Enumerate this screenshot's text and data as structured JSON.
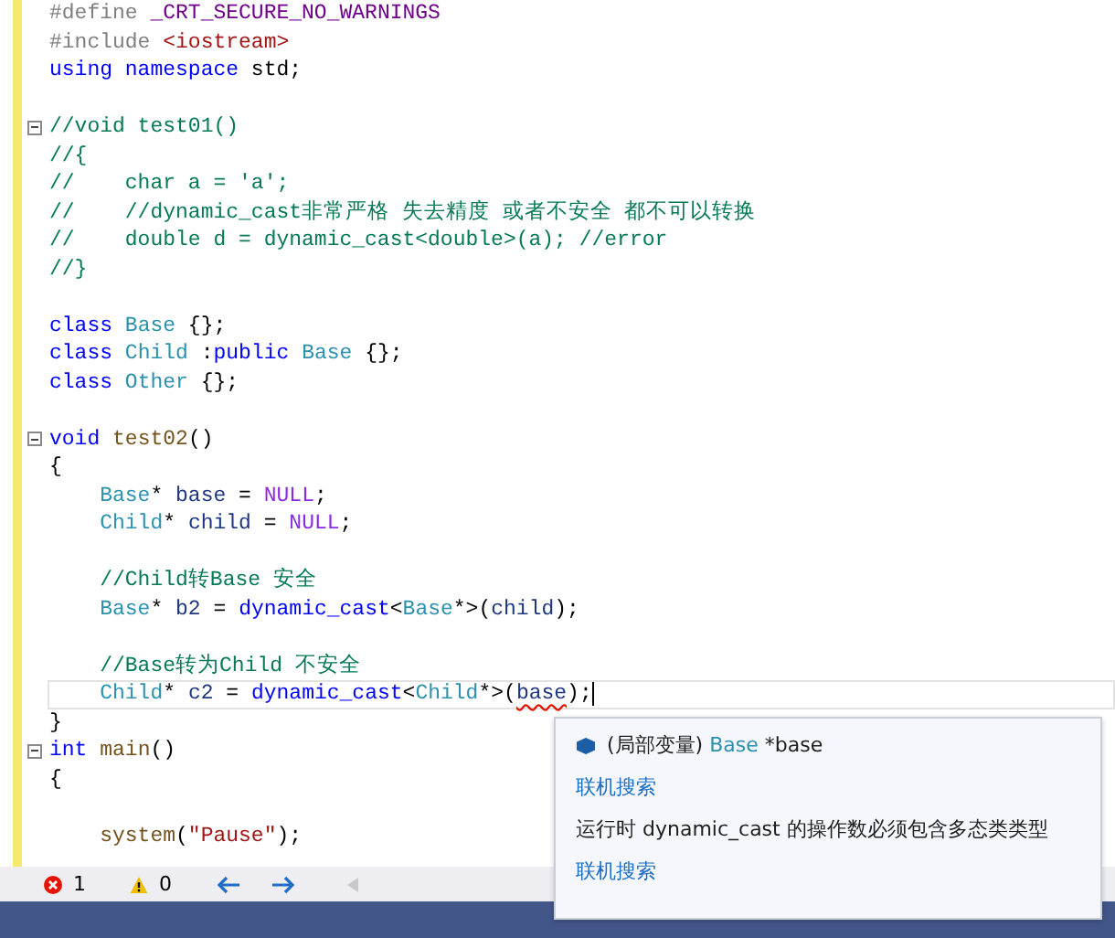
{
  "editor": {
    "lines": [
      {
        "fold": false,
        "current": false,
        "tokens": [
          {
            "kind": "macro",
            "t": "#define "
          },
          {
            "kind": "macroname",
            "t": "_CRT_SECURE_NO_WARNINGS"
          }
        ]
      },
      {
        "fold": false,
        "current": false,
        "tokens": [
          {
            "kind": "macro",
            "t": "#include "
          },
          {
            "kind": "string",
            "t": "<iostream>"
          }
        ]
      },
      {
        "fold": false,
        "current": false,
        "tokens": [
          {
            "kind": "kw",
            "t": "using namespace "
          },
          {
            "kind": "plain",
            "t": "std;"
          }
        ]
      },
      {
        "fold": false,
        "current": false
      },
      {
        "fold": true,
        "current": false,
        "tokens": [
          {
            "kind": "comment",
            "t": "//void test01()"
          }
        ]
      },
      {
        "fold": false,
        "current": false,
        "tokens": [
          {
            "kind": "comment",
            "t": "//{"
          }
        ]
      },
      {
        "fold": false,
        "current": false,
        "tokens": [
          {
            "kind": "comment",
            "t": "//    char a = 'a';"
          }
        ]
      },
      {
        "fold": false,
        "current": false,
        "tokens": [
          {
            "kind": "comment",
            "t": "//    //dynamic_cast非常严格 失去精度 或者不安全 都不可以转换"
          }
        ]
      },
      {
        "fold": false,
        "current": false,
        "tokens": [
          {
            "kind": "comment",
            "t": "//    double d = dynamic_cast<double>(a); //error"
          }
        ]
      },
      {
        "fold": false,
        "current": false,
        "tokens": [
          {
            "kind": "comment",
            "t": "//}"
          }
        ]
      },
      {
        "fold": false,
        "current": false
      },
      {
        "fold": false,
        "current": false,
        "tokens": [
          {
            "kind": "kw",
            "t": "class "
          },
          {
            "kind": "type",
            "t": "Base"
          },
          {
            "kind": "plain",
            "t": " {};"
          }
        ]
      },
      {
        "fold": false,
        "current": false,
        "tokens": [
          {
            "kind": "kw",
            "t": "class "
          },
          {
            "kind": "type",
            "t": "Child"
          },
          {
            "kind": "plain",
            "t": " :"
          },
          {
            "kind": "kw",
            "t": "public "
          },
          {
            "kind": "type",
            "t": "Base"
          },
          {
            "kind": "plain",
            "t": " {};"
          }
        ]
      },
      {
        "fold": false,
        "current": false,
        "tokens": [
          {
            "kind": "kw",
            "t": "class "
          },
          {
            "kind": "type",
            "t": "Other"
          },
          {
            "kind": "plain",
            "t": " {};"
          }
        ]
      },
      {
        "fold": false,
        "current": false
      },
      {
        "fold": true,
        "current": false,
        "tokens": [
          {
            "kind": "kw",
            "t": "void "
          },
          {
            "kind": "fn",
            "t": "test02"
          },
          {
            "kind": "plain",
            "t": "()"
          }
        ]
      },
      {
        "fold": false,
        "current": false,
        "tokens": [
          {
            "kind": "plain",
            "t": "{"
          }
        ]
      },
      {
        "fold": false,
        "current": false,
        "tokens": [
          {
            "kind": "type",
            "t": "    Base"
          },
          {
            "kind": "plain",
            "t": "* "
          },
          {
            "kind": "var",
            "t": "base"
          },
          {
            "kind": "plain",
            "t": " = "
          },
          {
            "kind": "null",
            "t": "NULL"
          },
          {
            "kind": "plain",
            "t": ";"
          }
        ]
      },
      {
        "fold": false,
        "current": false,
        "tokens": [
          {
            "kind": "type",
            "t": "    Child"
          },
          {
            "kind": "plain",
            "t": "* "
          },
          {
            "kind": "var",
            "t": "child"
          },
          {
            "kind": "plain",
            "t": " = "
          },
          {
            "kind": "null",
            "t": "NULL"
          },
          {
            "kind": "plain",
            "t": ";"
          }
        ]
      },
      {
        "fold": false,
        "current": false
      },
      {
        "fold": false,
        "current": false,
        "tokens": [
          {
            "kind": "comment",
            "t": "    //Child转Base 安全"
          }
        ]
      },
      {
        "fold": false,
        "current": false,
        "tokens": [
          {
            "kind": "type",
            "t": "    Base"
          },
          {
            "kind": "plain",
            "t": "* "
          },
          {
            "kind": "var",
            "t": "b2"
          },
          {
            "kind": "plain",
            "t": " = "
          },
          {
            "kind": "kw",
            "t": "dynamic_cast"
          },
          {
            "kind": "plain",
            "t": "<"
          },
          {
            "kind": "type",
            "t": "Base"
          },
          {
            "kind": "plain",
            "t": "*>("
          },
          {
            "kind": "var",
            "t": "child"
          },
          {
            "kind": "plain",
            "t": ");"
          }
        ]
      },
      {
        "fold": false,
        "current": false
      },
      {
        "fold": false,
        "current": false,
        "tokens": [
          {
            "kind": "comment",
            "t": "    //Base转为Child 不安全"
          }
        ]
      },
      {
        "fold": false,
        "current": true,
        "tokens": [
          {
            "kind": "type",
            "t": "    Child"
          },
          {
            "kind": "plain",
            "t": "* "
          },
          {
            "kind": "var",
            "t": "c2"
          },
          {
            "kind": "plain",
            "t": " = "
          },
          {
            "kind": "kw",
            "t": "dynamic_cast"
          },
          {
            "kind": "plain",
            "t": "<"
          },
          {
            "kind": "type",
            "t": "Child"
          },
          {
            "kind": "plain",
            "t": "*>("
          },
          {
            "kind": "err",
            "t": "base"
          },
          {
            "kind": "plain",
            "t": ");"
          }
        ]
      },
      {
        "fold": false,
        "current": false,
        "tokens": [
          {
            "kind": "plain",
            "t": "}"
          }
        ]
      },
      {
        "fold": true,
        "current": false,
        "tokens": [
          {
            "kind": "kw",
            "t": "int "
          },
          {
            "kind": "fn",
            "t": "main"
          },
          {
            "kind": "plain",
            "t": "()"
          }
        ]
      },
      {
        "fold": false,
        "current": false,
        "tokens": [
          {
            "kind": "plain",
            "t": "{"
          }
        ]
      },
      {
        "fold": false,
        "current": false
      },
      {
        "fold": false,
        "current": false,
        "tokens": [
          {
            "kind": "fn",
            "t": "    system"
          },
          {
            "kind": "plain",
            "t": "("
          },
          {
            "kind": "string",
            "t": "\"Pause\""
          },
          {
            "kind": "plain",
            "t": ");"
          }
        ]
      }
    ]
  },
  "tooltip": {
    "signature": [
      {
        "kind": "plain",
        "t": "(局部变量) "
      },
      {
        "kind": "type",
        "t": "Base"
      },
      {
        "kind": "plain",
        "t": " *base"
      }
    ],
    "links": [
      "联机搜索",
      "联机搜索"
    ],
    "message": "运行时 dynamic_cast 的操作数必须包含多态类类型"
  },
  "status_bar": {
    "errors": "1",
    "warnings": "0"
  }
}
